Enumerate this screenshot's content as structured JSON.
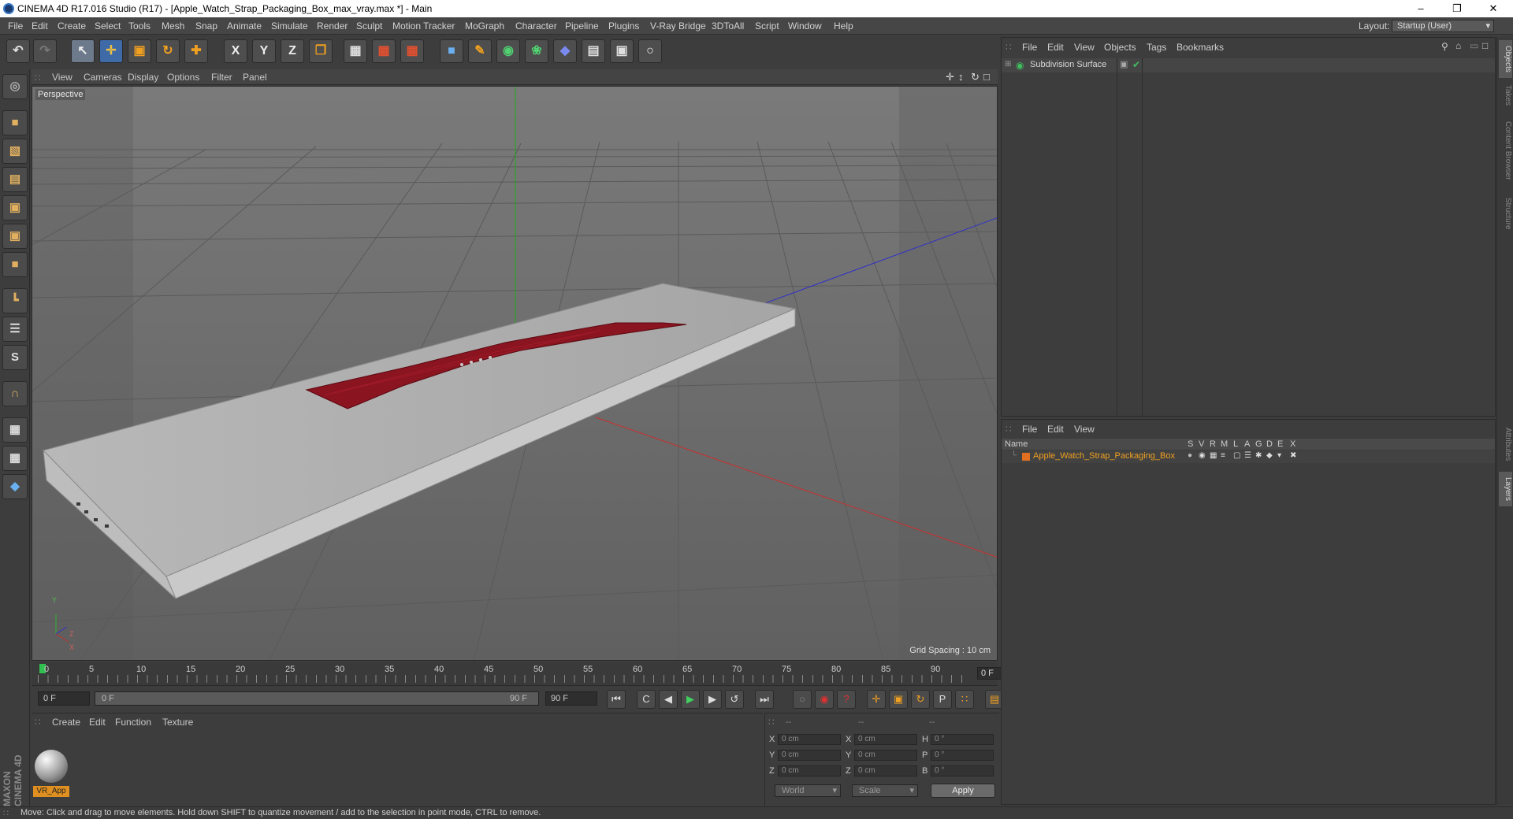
{
  "window": {
    "title": "CINEMA 4D R17.016 Studio (R17) - [Apple_Watch_Strap_Packaging_Box_max_vray.max *] - Main",
    "controls": [
      "minimize",
      "restore",
      "close"
    ]
  },
  "menu": [
    "File",
    "Edit",
    "Create",
    "Select",
    "Tools",
    "Mesh",
    "Snap",
    "Animate",
    "Simulate",
    "Render",
    "Sculpt",
    "Motion Tracker",
    "MoGraph",
    "Character",
    "Pipeline",
    "Plugins",
    "V-Ray Bridge",
    "3DToAll",
    "Script",
    "Window",
    "Help"
  ],
  "layout": {
    "label": "Layout:",
    "value": "Startup (User)"
  },
  "toolbar": {
    "axis_x": "X",
    "axis_y": "Y",
    "axis_z": "Z"
  },
  "viewport": {
    "menu": [
      "View",
      "Cameras",
      "Display",
      "Options",
      "Filter",
      "Panel"
    ],
    "camera_label": "Perspective",
    "grid_spacing": "Grid Spacing : 10 cm",
    "axis_labels": {
      "y": "Y",
      "x": "X",
      "z": "Z"
    }
  },
  "timeline": {
    "ticks": [
      "0",
      "5",
      "10",
      "15",
      "20",
      "25",
      "30",
      "35",
      "40",
      "45",
      "50",
      "55",
      "60",
      "65",
      "70",
      "75",
      "80",
      "85",
      "90"
    ],
    "current_frame": "0 F"
  },
  "transport": {
    "start": "0 F",
    "range_start": "0 F",
    "range_end": "90 F",
    "end": "90 F"
  },
  "material_panel": {
    "menu": [
      "Create",
      "Edit",
      "Function",
      "Texture"
    ],
    "materials": [
      {
        "name": "VR_App"
      }
    ]
  },
  "coords": {
    "headers": [
      "--",
      "--",
      "--"
    ],
    "rows": [
      {
        "a": "X",
        "av": "0 cm",
        "b": "X",
        "bv": "0 cm",
        "c": "H",
        "cv": "0 °"
      },
      {
        "a": "Y",
        "av": "0 cm",
        "b": "Y",
        "bv": "0 cm",
        "c": "P",
        "cv": "0 °"
      },
      {
        "a": "Z",
        "av": "0 cm",
        "b": "Z",
        "bv": "0 cm",
        "c": "B",
        "cv": "0 °"
      }
    ],
    "world": "World",
    "scale": "Scale",
    "apply": "Apply"
  },
  "objects_panel": {
    "menu": [
      "File",
      "Edit",
      "View",
      "Objects",
      "Tags",
      "Bookmarks"
    ],
    "items": [
      {
        "name": "Subdivision Surface"
      }
    ]
  },
  "layers_panel": {
    "menu": [
      "File",
      "Edit",
      "View"
    ],
    "header": "Name",
    "flags": [
      "S",
      "V",
      "R",
      "M",
      "L",
      "A",
      "G",
      "D",
      "E",
      "X"
    ],
    "items": [
      {
        "name": "Apple_Watch_Strap_Packaging_Box",
        "color": "#e07020"
      }
    ]
  },
  "side_tabs": [
    "Objects",
    "Takes",
    "Content Browser",
    "Structure",
    "Attributes",
    "Layers"
  ],
  "status": "Move: Click and drag to move elements. Hold down SHIFT to quantize movement / add to the selection in point mode, CTRL to remove.",
  "branding": "MAXON CINEMA 4D",
  "colors": {
    "accent": "#e09020",
    "layer": "#e07020",
    "strap": "#8a1420"
  }
}
